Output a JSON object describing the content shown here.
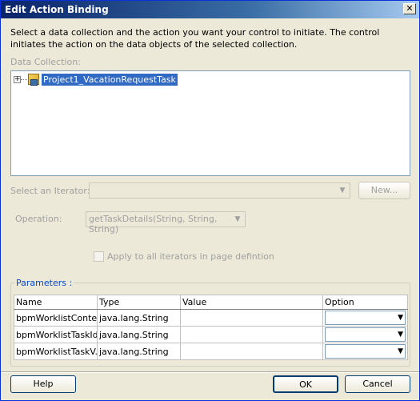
{
  "window": {
    "title": "Edit Action Binding",
    "close_glyph": "✕"
  },
  "description": "Select a data collection and the action you want your control to initiate. The control initiates the action on the data objects of the selected collection.",
  "data_collection": {
    "label": "Data Collection:",
    "tree_items": [
      {
        "label": "Project1_VacationRequestTask",
        "expanded": false,
        "selected": true,
        "icon": "data-control-icon"
      }
    ]
  },
  "iterator": {
    "label": "Select an Iterator:",
    "value": "",
    "new_button": "New..."
  },
  "operation": {
    "label": "Operation:",
    "value": "getTaskDetails(String, String, String)"
  },
  "apply_all": {
    "label": "Apply to all iterators in page defintion",
    "checked": false
  },
  "parameters": {
    "title": "Parameters :",
    "columns": [
      "Name",
      "Type",
      "Value",
      "Option"
    ],
    "rows": [
      {
        "name": "bpmWorklistContext",
        "type": "java.lang.String",
        "value": "",
        "option": ""
      },
      {
        "name": "bpmWorklistTaskId",
        "type": "java.lang.String",
        "value": "",
        "option": ""
      },
      {
        "name": "bpmWorklistTaskV...",
        "type": "java.lang.String",
        "value": "",
        "option": ""
      }
    ]
  },
  "buttons": {
    "help": "Help",
    "ok": "OK",
    "cancel": "Cancel"
  },
  "colors": {
    "title_gradient_start": "#0a246a",
    "selection": "#316ac5",
    "dialog_bg": "#ece9d8",
    "group_title": "#0046d5"
  }
}
